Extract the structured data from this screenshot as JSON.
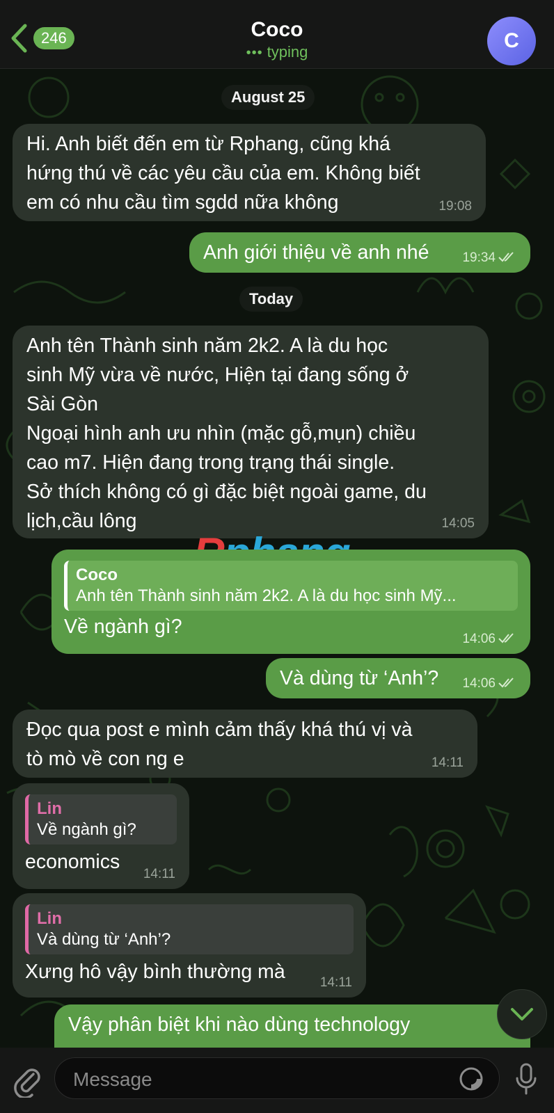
{
  "header": {
    "back_count": "246",
    "title": "Coco",
    "status": "typing",
    "avatar_letter": "C"
  },
  "dates": [
    "August 25",
    "Today"
  ],
  "messages": [
    {
      "dir": "in",
      "lines": [
        "Hi. Anh biết đến em từ Rphang, cũng khá",
        "hứng thú về các yêu cầu của em. Không biết",
        "em có nhu cầu tìm sgdd nữa không"
      ],
      "time": "19:08"
    },
    {
      "dir": "out",
      "lines": [
        "Anh giới thiệu về anh nhé"
      ],
      "time": "19:34"
    },
    {
      "dir": "in",
      "lines": [
        "Anh tên Thành sinh năm 2k2. A là du học",
        "sinh Mỹ vừa về nước, Hiện tại đang sống ở",
        "Sài Gòn",
        "Ngoại hình anh ưu nhìn (mặc gỗ,mụn) chiều",
        "cao m7. Hiện đang trong trạng thái single.",
        "Sở thích không có gì đặc biệt ngoài game, du",
        "lịch,cầu lông"
      ],
      "time": "14:05"
    },
    {
      "dir": "out",
      "reply_name": "Coco",
      "reply_text": "Anh tên Thành sinh năm 2k2. A là du học sinh Mỹ...",
      "lines": [
        "Về ngành gì?"
      ],
      "time": "14:06"
    },
    {
      "dir": "out",
      "lines": [
        "Và dùng từ ‘Anh’?"
      ],
      "time": "14:06"
    },
    {
      "dir": "in",
      "lines": [
        "Đọc qua post e mình cảm thấy khá thú vị và",
        "tò mò về con ng e"
      ],
      "time": "14:11"
    },
    {
      "dir": "in",
      "reply_name": "Lin",
      "reply_text": "Về ngành gì?",
      "lines": [
        "economics"
      ],
      "time": "14:11"
    },
    {
      "dir": "in",
      "reply_name": "Lin",
      "reply_text": "Và dùng từ ‘Anh’?",
      "lines": [
        "Xưng hô vậy bình thường mà"
      ],
      "time": "14:11"
    },
    {
      "dir": "out",
      "lines": [
        "Vậy phân biệt khi nào dùng technology"
      ],
      "time": ""
    }
  ],
  "watermark": {
    "first": "R",
    "rest": "phang"
  },
  "input": {
    "placeholder": "Message"
  },
  "icons": [
    "back-chevron-icon",
    "double-check-icon",
    "chevron-down-icon",
    "paperclip-icon",
    "sticker-icon",
    "microphone-icon"
  ],
  "colors": {
    "incoming": "#2c342c",
    "outgoing": "#5a9c47",
    "accent": "#6ab454",
    "avatar": "#7b7ff2"
  }
}
